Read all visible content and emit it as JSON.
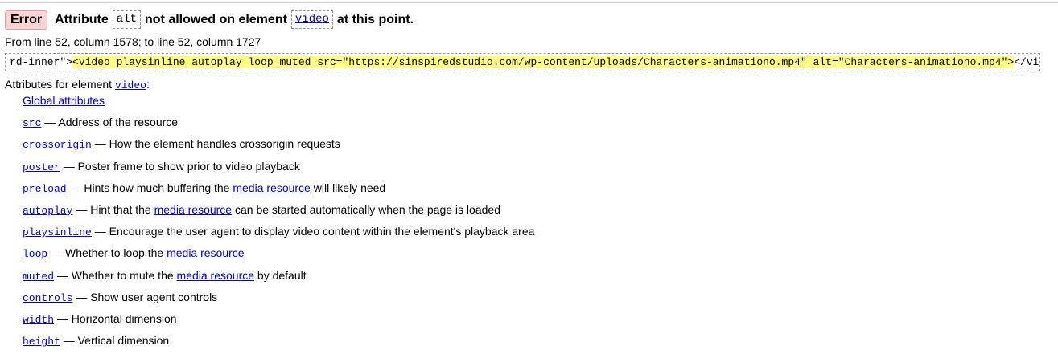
{
  "error": {
    "badge": "Error",
    "msg_part1": "Attribute",
    "attr": "alt",
    "msg_part2": "not allowed on element",
    "element": "video",
    "msg_part3": "at this point."
  },
  "location": "From line 52, column 1578; to line 52, column 1727",
  "extract": {
    "before": "rd-inner\">",
    "highlight": "<video playsinline autoplay loop muted src=\"https://sinspiredstudio.com/wp-content/uploads/Characters-animationo.mp4\" alt=\"Characters-animationo.mp4\">",
    "after": "</vide"
  },
  "attributes_heading": {
    "prefix": "Attributes for element",
    "element": "video",
    "suffix": ":"
  },
  "attributes": {
    "global": "Global attributes",
    "src": {
      "name": "src",
      "desc": "— Address of the resource"
    },
    "crossorigin": {
      "name": "crossorigin",
      "desc": "— How the element handles crossorigin requests"
    },
    "poster": {
      "name": "poster",
      "desc": "— Poster frame to show prior to video playback"
    },
    "preload": {
      "name": "preload",
      "desc_before": "— Hints how much buffering the",
      "link": "media resource",
      "desc_after": "will likely need"
    },
    "autoplay": {
      "name": "autoplay",
      "desc_before": "— Hint that the",
      "link": "media resource",
      "desc_after": "can be started automatically when the page is loaded"
    },
    "playsinline": {
      "name": "playsinline",
      "desc": "— Encourage the user agent to display video content within the element's playback area"
    },
    "loop": {
      "name": "loop",
      "desc_before": "— Whether to loop the",
      "link": "media resource"
    },
    "muted": {
      "name": "muted",
      "desc_before": "— Whether to mute the",
      "link": "media resource",
      "desc_after": "by default"
    },
    "controls": {
      "name": "controls",
      "desc": "— Show user agent controls"
    },
    "width": {
      "name": "width",
      "desc": "— Horizontal dimension"
    },
    "height": {
      "name": "height",
      "desc": "— Vertical dimension"
    }
  }
}
